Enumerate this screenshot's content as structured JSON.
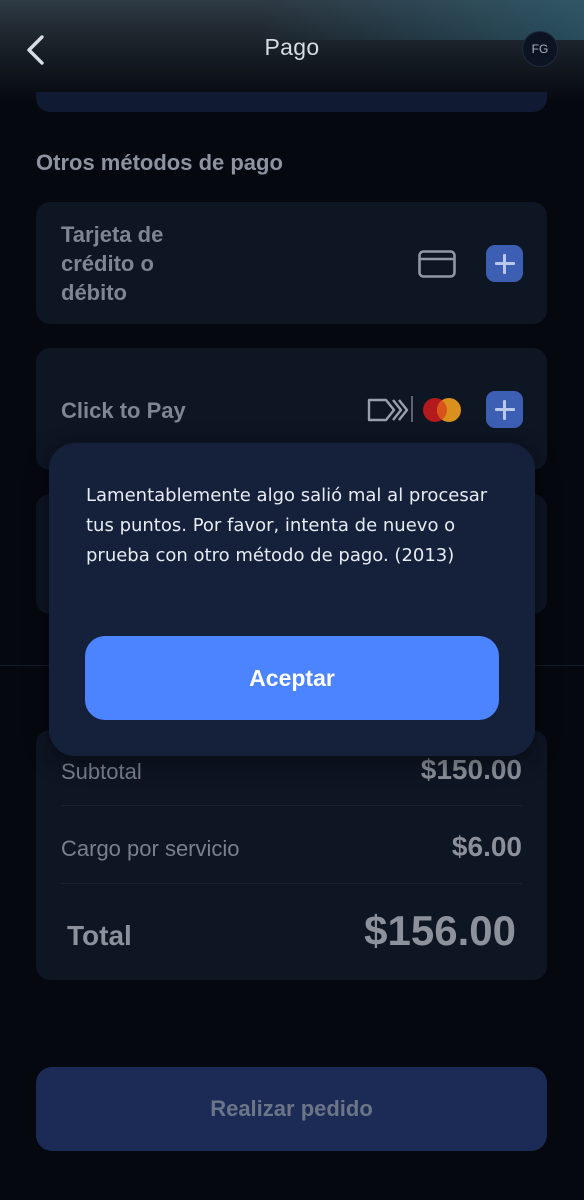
{
  "header": {
    "title": "Pago",
    "avatar_initials": "FG",
    "back_icon": "chevron-left-icon"
  },
  "other_methods": {
    "section_title": "Otros métodos de pago",
    "card_payment": {
      "label_lines": [
        "Tarjeta de",
        "crédito o",
        "débito"
      ],
      "icon": "credit-card-icon",
      "add_icon": "plus-icon"
    },
    "click_to_pay": {
      "label": "Click to Pay",
      "icons": [
        "click-to-pay-icon",
        "mastercard-icon"
      ],
      "add_icon": "plus-icon"
    }
  },
  "summary": {
    "subtotal_label": "Subtotal",
    "subtotal_value": "$150.00",
    "fee_label": "Cargo por servicio",
    "fee_value": "$6.00",
    "total_label": "Total",
    "total_value": "$156.00"
  },
  "place_order_label": "Realizar pedido",
  "modal": {
    "message": "Lamentablemente algo salió mal al procesar tus puntos. Por favor, intenta de nuevo o prueba con otro método de pago. (2013)",
    "accept_label": "Aceptar"
  },
  "colors": {
    "accent": "#4c84ff",
    "modal_bg": "#15203a",
    "card_bg": "#0e1523",
    "page_bg": "#05080f"
  }
}
